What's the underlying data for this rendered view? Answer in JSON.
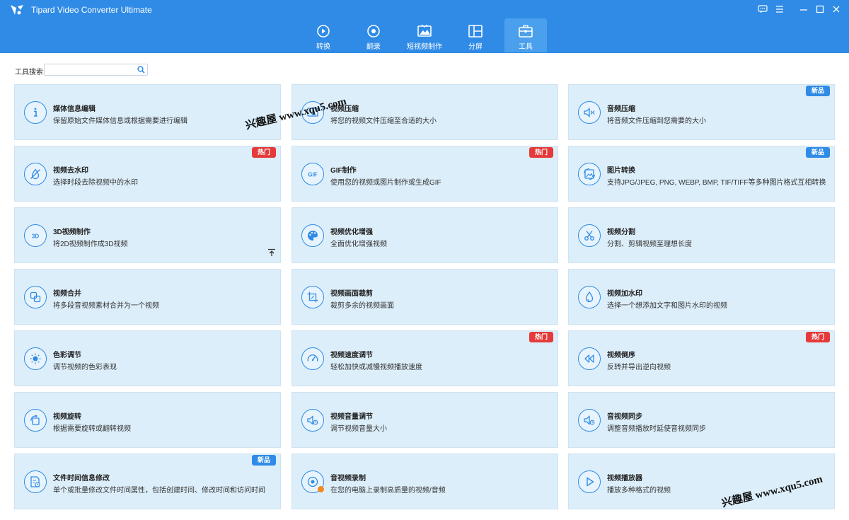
{
  "app": {
    "title": "Tipard Video Converter Ultimate"
  },
  "nav": [
    {
      "label": "转换",
      "icon": "convert-icon"
    },
    {
      "label": "翻录",
      "icon": "rip-icon"
    },
    {
      "label": "短视频制作",
      "icon": "mv-icon"
    },
    {
      "label": "分屏",
      "icon": "collage-icon"
    },
    {
      "label": "工具",
      "icon": "toolbox-icon",
      "active": true
    }
  ],
  "search": {
    "label": "工具搜索:",
    "value": "",
    "placeholder": ""
  },
  "badges": {
    "hot": "热门",
    "new": "新品"
  },
  "tools": [
    {
      "title": "媒体信息编辑",
      "desc": "保留原始文件媒体信息或根据需要进行编辑",
      "icon": "info-icon",
      "badge": ""
    },
    {
      "title": "视频压缩",
      "desc": "将您的视频文件压缩至合适的大小",
      "icon": "video-compress-icon",
      "badge": ""
    },
    {
      "title": "音频压缩",
      "desc": "将音频文件压缩到您需要的大小",
      "icon": "audio-compress-icon",
      "badge": "new"
    },
    {
      "title": "视频去水印",
      "desc": "选择时段去除视频中的水印",
      "icon": "watermark-remove-icon",
      "badge": "hot"
    },
    {
      "title": "GIF制作",
      "desc": "使用您的视频或图片制作或生成GIF",
      "icon": "gif-icon",
      "badge": "hot"
    },
    {
      "title": "图片转换",
      "desc": "支持JPG/JPEG, PNG, WEBP, BMP, TIF/TIFF等多种图片格式互相转换",
      "icon": "image-convert-icon",
      "badge": "new"
    },
    {
      "title": "3D视频制作",
      "desc": "将2D视频制作成3D视频",
      "icon": "3d-icon",
      "badge": ""
    },
    {
      "title": "视频优化增强",
      "desc": "全面优化增强视频",
      "icon": "palette-icon",
      "badge": ""
    },
    {
      "title": "视频分割",
      "desc": "分割、剪辑视频至理想长度",
      "icon": "scissors-icon",
      "badge": ""
    },
    {
      "title": "视频合并",
      "desc": "将多段音视频素材合并为一个视频",
      "icon": "merge-icon",
      "badge": ""
    },
    {
      "title": "视频画面裁剪",
      "desc": "裁剪多余的视频画面",
      "icon": "crop-icon",
      "badge": ""
    },
    {
      "title": "视频加水印",
      "desc": "选择一个想添加文字和图片水印的视频",
      "icon": "watermark-add-icon",
      "badge": ""
    },
    {
      "title": "色彩调节",
      "desc": "调节视频的色彩表现",
      "icon": "color-adjust-icon",
      "badge": ""
    },
    {
      "title": "视频速度调节",
      "desc": "轻松加快或减慢视频播放速度",
      "icon": "speed-icon",
      "badge": "hot"
    },
    {
      "title": "视频倒序",
      "desc": "反转并导出逆向视频",
      "icon": "reverse-icon",
      "badge": "hot"
    },
    {
      "title": "视频旋转",
      "desc": "根据需要旋转或翻转视频",
      "icon": "rotate-icon",
      "badge": ""
    },
    {
      "title": "视频音量调节",
      "desc": "调节视频音量大小",
      "icon": "volume-icon",
      "badge": ""
    },
    {
      "title": "音视频同步",
      "desc": "调整音频播放时延使音视频同步",
      "icon": "audio-sync-icon",
      "badge": ""
    },
    {
      "title": "文件时间信息修改",
      "desc": "单个或批量修改文件时间属性，包括创建时间、修改时间和访问时间",
      "icon": "file-date-icon",
      "badge": "new"
    },
    {
      "title": "音视频录制",
      "desc": "在您的电脑上录制高质量的视频/音频",
      "icon": "recorder-icon",
      "badge": ""
    },
    {
      "title": "视频播放器",
      "desc": "播放多种格式的视频",
      "icon": "player-icon",
      "badge": ""
    }
  ],
  "watermarks": [
    "兴趣屋 www.xqu5.com",
    "兴趣屋 www.xqu5.com"
  ],
  "colors": {
    "header": "#2f8be6",
    "card_bg": "#dceefa",
    "hot": "#e63a3a",
    "new": "#2f8be6"
  }
}
